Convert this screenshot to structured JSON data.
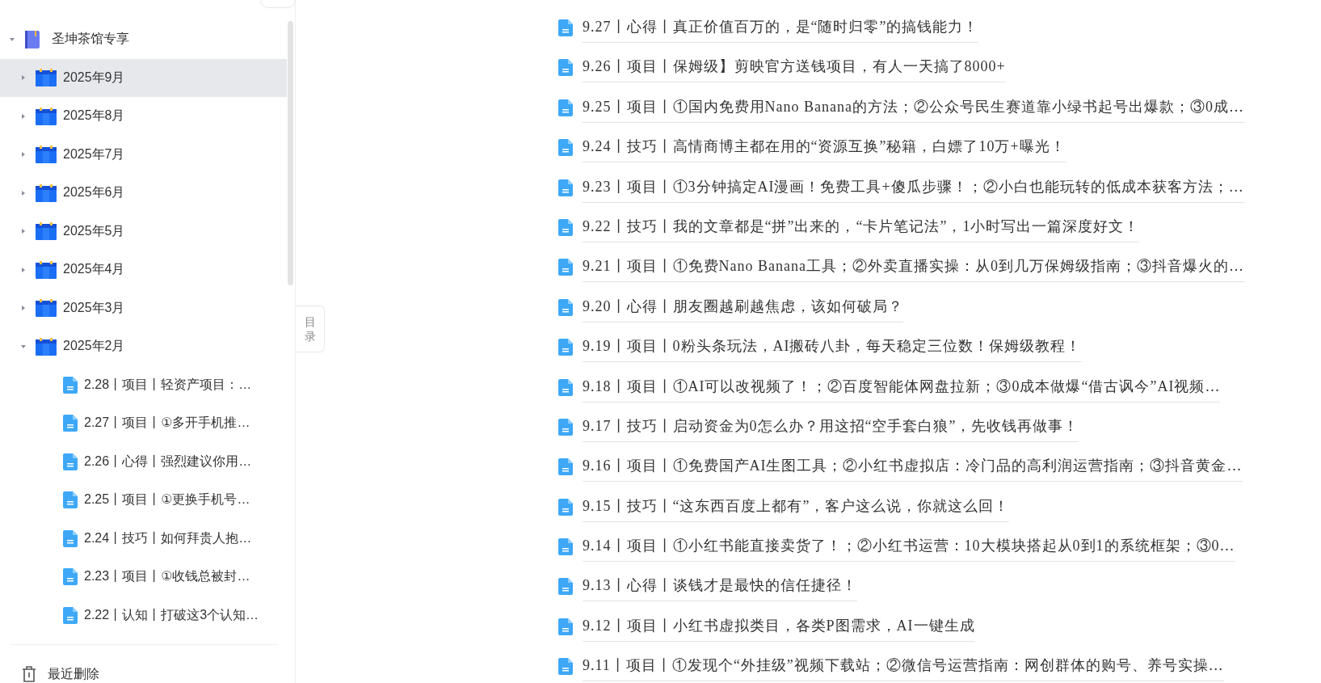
{
  "sidebar": {
    "tree": [
      {
        "kind": "book",
        "label": "圣坤茶馆专享",
        "expanded": true,
        "selected": false,
        "children": [
          {
            "kind": "month",
            "label": "2025年9月",
            "expanded": false,
            "selected": true
          },
          {
            "kind": "month",
            "label": "2025年8月",
            "expanded": false,
            "selected": false
          },
          {
            "kind": "month",
            "label": "2025年7月",
            "expanded": false,
            "selected": false
          },
          {
            "kind": "month",
            "label": "2025年6月",
            "expanded": false,
            "selected": false
          },
          {
            "kind": "month",
            "label": "2025年5月",
            "expanded": false,
            "selected": false
          },
          {
            "kind": "month",
            "label": "2025年4月",
            "expanded": false,
            "selected": false
          },
          {
            "kind": "month",
            "label": "2025年3月",
            "expanded": false,
            "selected": false
          },
          {
            "kind": "month",
            "label": "2025年2月",
            "expanded": true,
            "selected": false,
            "children": [
              {
                "kind": "doc",
                "label": "2.28丨项目丨轻资产项目：…",
                "selected": false
              },
              {
                "kind": "doc",
                "label": "2.27丨项目丨①多开手机推…",
                "selected": false
              },
              {
                "kind": "doc",
                "label": "2.26丨心得丨强烈建议你用…",
                "selected": false
              },
              {
                "kind": "doc",
                "label": "2.25丨项目丨①更换手机号…",
                "selected": false
              },
              {
                "kind": "doc",
                "label": "2.24丨技巧丨如何拜贵人抱…",
                "selected": false
              },
              {
                "kind": "doc",
                "label": "2.23丨项目丨①收钱总被封…",
                "selected": false
              },
              {
                "kind": "doc",
                "label": "2.22丨认知丨打破这3个认知…",
                "selected": false
              }
            ]
          }
        ]
      }
    ],
    "trash": {
      "label": "最近删除"
    }
  },
  "toc_tab": {
    "label": "目录"
  },
  "documents": [
    {
      "title": "9.27丨心得丨真正价值百万的，是“随时归零”的搞钱能力！"
    },
    {
      "title": "9.26丨项目丨保姆级】剪映官方送钱项目，有人一天搞了8000+"
    },
    {
      "title": "9.25丨项目丨①国内免费用Nano Banana的方法；②公众号民生赛道靠小绿书起号出爆款；③0成…"
    },
    {
      "title": "9.24丨技巧丨高情商博主都在用的“资源互换”秘籍，白嫖了10万+曝光！"
    },
    {
      "title": "9.23丨项目丨①3分钟搞定AI漫画！免费工具+傻瓜步骤！；②小白也能玩转的低成本获客方法；…"
    },
    {
      "title": "9.22丨技巧丨我的文章都是“拼”出来的，“卡片笔记法”，1小时写出一篇深度好文！"
    },
    {
      "title": "9.21丨项目丨①免费Nano Banana工具；②外卖直播实操：从0到几万保姆级指南；③抖音爆火的…"
    },
    {
      "title": "9.20丨心得丨朋友圈越刷越焦虑，该如何破局？"
    },
    {
      "title": "9.19丨项目丨0粉头条玩法，AI搬砖八卦，每天稳定三位数！保姆级教程！"
    },
    {
      "title": "9.18丨项目丨①AI可以改视频了！；②百度智能体网盘拉新；③0成本做爆“借古讽今”AI视频…"
    },
    {
      "title": "9.17丨技巧丨启动资金为0怎么办？用这招“空手套白狼”，先收钱再做事！"
    },
    {
      "title": "9.16丨项目丨①免费国产AI生图工具；②小红书虚拟店：冷门品的高利润运营指南；③抖音黄金…"
    },
    {
      "title": "9.15丨技巧丨“这东西百度上都有”，客户这么说，你就这么回！"
    },
    {
      "title": "9.14丨项目丨①小红书能直接卖货了！；②小红书运营：10大模块搭起从0到1的系统框架；③0…"
    },
    {
      "title": "9.13丨心得丨谈钱才是最快的信任捷径！"
    },
    {
      "title": "9.12丨项目丨小红书虚拟类目，各类P图需求，AI一键生成"
    },
    {
      "title": "9.11丨项目丨①发现个“外挂级”视频下载站；②微信号运营指南：网创群体的购号、养号实操…"
    }
  ]
}
